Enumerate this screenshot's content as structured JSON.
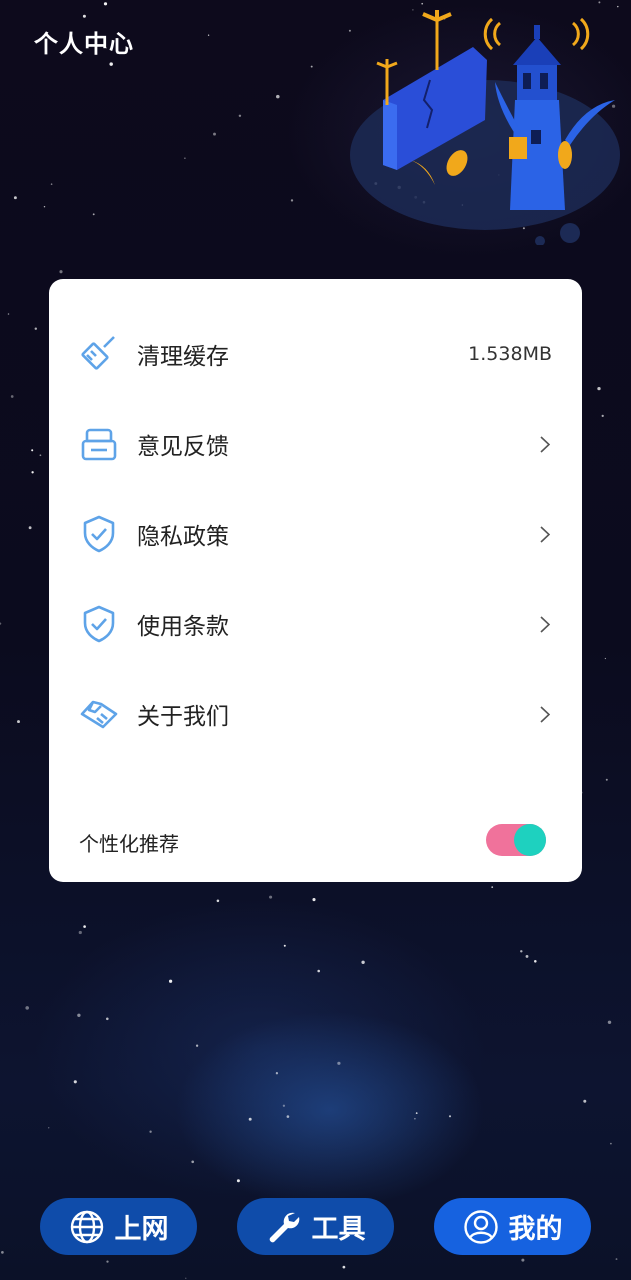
{
  "header": {
    "title": "个人中心"
  },
  "menu": {
    "items": [
      {
        "label": "清理缓存",
        "icon": "broom-icon",
        "value": "1.538MB"
      },
      {
        "label": "意见反馈",
        "icon": "feedback-box-icon"
      },
      {
        "label": "隐私政策",
        "icon": "shield-check-icon"
      },
      {
        "label": "使用条款",
        "icon": "shield-check-icon"
      },
      {
        "label": "关于我们",
        "icon": "handshake-icon"
      }
    ],
    "toggle": {
      "label": "个性化推荐",
      "on": true
    }
  },
  "bottom_nav": {
    "items": [
      {
        "label": "上网",
        "icon": "globe-icon",
        "active": false
      },
      {
        "label": "工具",
        "icon": "wrench-icon",
        "active": false
      },
      {
        "label": "我的",
        "icon": "user-icon",
        "active": true
      }
    ]
  },
  "colors": {
    "accent_icon": "#5ea3e8",
    "nav_button": "#0f4caa",
    "nav_button_active": "#1662e0",
    "toggle_track": "#f0729b",
    "toggle_knob": "#1ed1bf"
  }
}
